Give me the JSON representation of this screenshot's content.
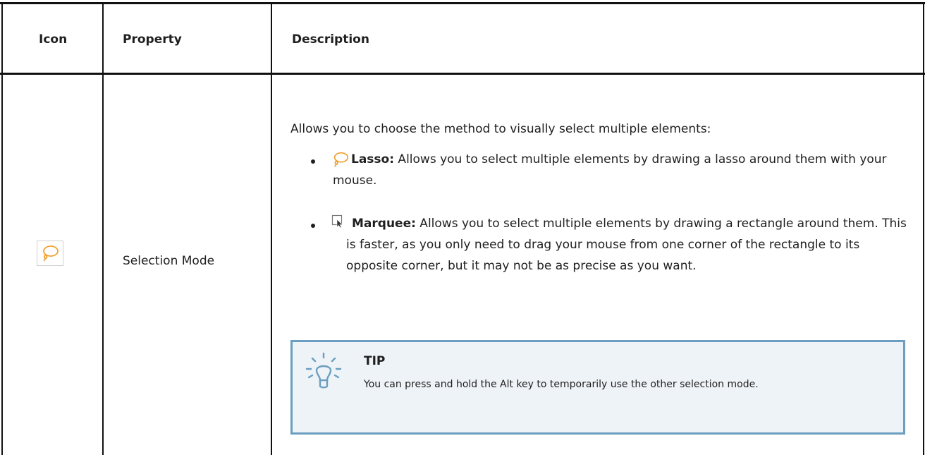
{
  "table": {
    "headers": {
      "icon": "Icon",
      "property": "Property",
      "description": "Description"
    },
    "row": {
      "icon_name": "lasso-icon",
      "property": "Selection Mode",
      "description_intro": "Allows you to choose the method to visually select multiple elements:",
      "options": [
        {
          "icon_name": "lasso-icon",
          "label": "Lasso:",
          "text": " Allows you to select multiple elements by drawing a lasso around them with your mouse."
        },
        {
          "icon_name": "marquee-icon",
          "label": "Marquee:",
          "text": " Allows you to select multiple elements by drawing a rectangle around them. This is faster, as you only need to drag your mouse from one corner of the rectangle to its opposite corner, but it may not be as precise as you want."
        }
      ],
      "tip": {
        "icon_name": "lightbulb-icon",
        "title": "TIP",
        "body": "You can press and hold the Alt key to temporarily use the other selection mode."
      }
    }
  },
  "colors": {
    "accent_orange": "#f0a030",
    "tip_border": "#6b9ec0",
    "tip_background": "#eef3f7"
  }
}
